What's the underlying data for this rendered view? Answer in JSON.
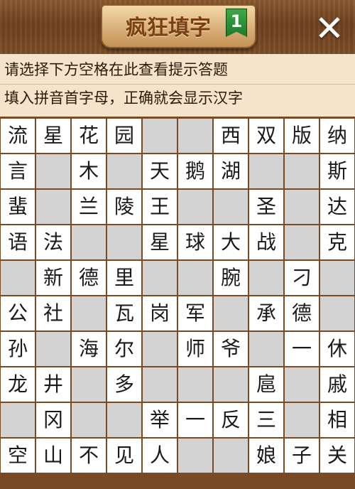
{
  "header": {
    "title": "疯狂填字",
    "level": "1",
    "close_icon": "close-x-icon"
  },
  "hints": {
    "line1": "请选择下方空格在此查看提示答题",
    "line2": "填入拼音首字母，正确就会显示汉字"
  },
  "grid": [
    [
      "流",
      "星",
      "花",
      "园",
      "#",
      "#",
      "西",
      "双",
      "版",
      "纳"
    ],
    [
      "言",
      "#",
      "木",
      "#",
      "天",
      "鹅",
      "湖",
      "#",
      "#",
      "斯"
    ],
    [
      "蜚",
      "#",
      "兰",
      "陵",
      "王",
      "#",
      "#",
      "圣",
      "#",
      "达"
    ],
    [
      "语",
      "法",
      "#",
      "#",
      "星",
      "球",
      "大",
      "战",
      "#",
      "克"
    ],
    [
      "#",
      "新",
      "德",
      "里",
      "#",
      "#",
      "腕",
      "#",
      "刁",
      "#"
    ],
    [
      "公",
      "社",
      "#",
      "瓦",
      "岗",
      "军",
      "#",
      "承",
      "德",
      "#"
    ],
    [
      "孙",
      "#",
      "海",
      "尔",
      "#",
      "师",
      "爷",
      "#",
      "一",
      "休"
    ],
    [
      "龙",
      "井",
      "#",
      "多",
      "#",
      "#",
      "#",
      "扈",
      "#",
      "戚"
    ],
    [
      "#",
      "冈",
      "#",
      "#",
      "举",
      "一",
      "反",
      "三",
      "#",
      "相"
    ],
    [
      "空",
      "山",
      "不",
      "见",
      "人",
      "#",
      "#",
      "娘",
      "子",
      "关"
    ]
  ],
  "colors": {
    "wood": "#7a4a24",
    "blank_cell": "#d3d3d3",
    "hint_bg": "#f5e4cc",
    "badge_green": "#2e9a3c"
  }
}
